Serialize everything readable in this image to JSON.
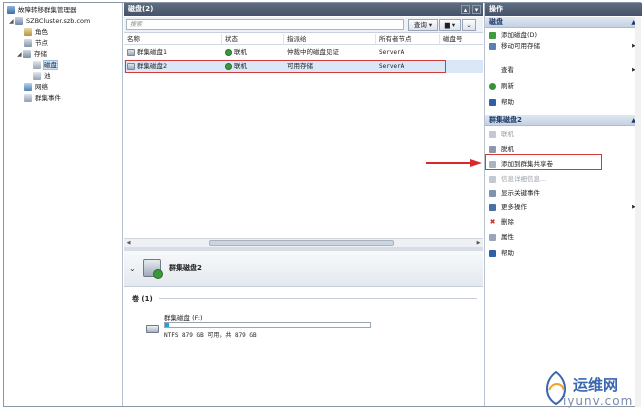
{
  "tree": {
    "root": "故障转移群集管理器",
    "cluster": "SZBCluster.szb.com",
    "items": [
      "角色",
      "节点",
      "存储",
      "磁盘",
      "池",
      "网络",
      "群集事件"
    ]
  },
  "center": {
    "title": "磁盘(2)",
    "search_placeholder": "搜索",
    "query_label": "查询",
    "columns": [
      "名称",
      "状态",
      "指派给",
      "所有者节点",
      "磁盘号"
    ],
    "rows": [
      {
        "name": "群集磁盘1",
        "status": "联机",
        "assigned": "仲裁中的磁盘见证",
        "owner": "ServerA",
        "num": ""
      },
      {
        "name": "群集磁盘2",
        "status": "联机",
        "assigned": "可用存储",
        "owner": "ServerA",
        "num": ""
      }
    ],
    "detail_title": "群集磁盘2",
    "volume_section": "卷 (1)",
    "volume_name": "群集磁盘 (F:)",
    "volume_info": "NTFS 879 GB 可用，共 879 GB",
    "volume_used_fraction": 0.02
  },
  "actions": {
    "header": "操作",
    "section1": "磁盘",
    "section1_items": [
      "添加磁盘(D)",
      "移动可用存储",
      "查看",
      "刷新",
      "帮助"
    ],
    "section2": "群集磁盘2",
    "section2_items": [
      "联机",
      "脱机",
      "添加到群集共享卷",
      "信息详细信息...",
      "显示关键事件",
      "更多操作",
      "删除",
      "属性",
      "帮助"
    ]
  },
  "watermark": {
    "text": "运维网",
    "url": "iyunv.com"
  }
}
